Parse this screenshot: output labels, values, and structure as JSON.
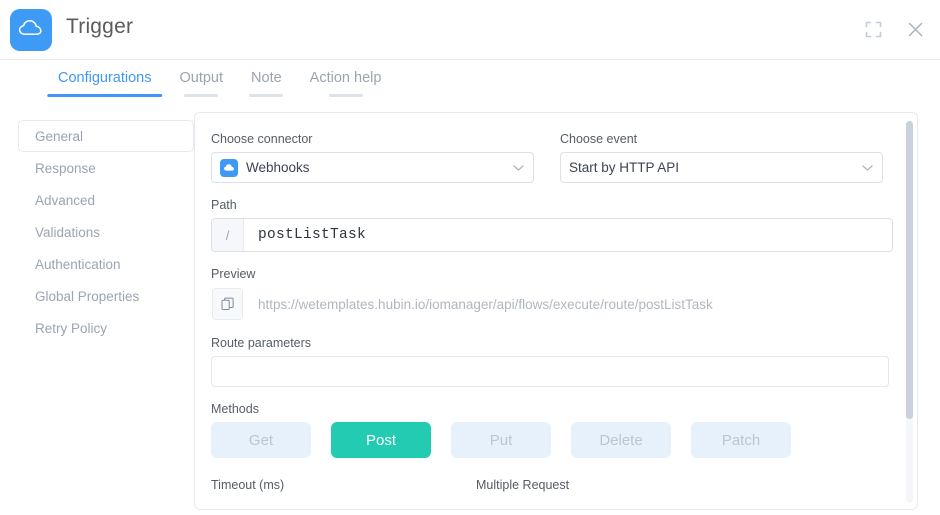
{
  "window": {
    "title": "Trigger",
    "logo_icon": "cloud-icon",
    "expand_icon": "fullscreen-icon",
    "close_icon": "close-icon"
  },
  "tabs": [
    {
      "label": "Configurations",
      "active": true
    },
    {
      "label": "Output",
      "active": false
    },
    {
      "label": "Note",
      "active": false
    },
    {
      "label": "Action help",
      "active": false
    }
  ],
  "sidebar": {
    "items": [
      {
        "label": "General",
        "selected": true
      },
      {
        "label": "Response",
        "selected": false
      },
      {
        "label": "Advanced",
        "selected": false
      },
      {
        "label": "Validations",
        "selected": false
      },
      {
        "label": "Authentication",
        "selected": false
      },
      {
        "label": "Global Properties",
        "selected": false
      },
      {
        "label": "Retry Policy",
        "selected": false
      }
    ]
  },
  "form": {
    "connector": {
      "label": "Choose connector",
      "value": "Webhooks",
      "icon": "cloud-icon",
      "chevron": "chevron-down-icon"
    },
    "event": {
      "label": "Choose event",
      "value": "Start by HTTP API",
      "chevron": "chevron-down-icon"
    },
    "path": {
      "label": "Path",
      "prefix": "/",
      "value": "postListTask",
      "placeholder": ""
    },
    "preview": {
      "label": "Preview",
      "value": "https://wetemplates.hubin.io/iomanager/api/flows/execute/route/postListTask",
      "copy_icon": "copy-icon"
    },
    "route_parameters": {
      "label": "Route parameters",
      "value": "",
      "placeholder": ""
    },
    "methods": {
      "label": "Methods",
      "options": [
        {
          "label": "Get",
          "active": false
        },
        {
          "label": "Post",
          "active": true
        },
        {
          "label": "Put",
          "active": false
        },
        {
          "label": "Delete",
          "active": false
        },
        {
          "label": "Patch",
          "active": false
        }
      ]
    },
    "timeout": {
      "label": "Timeout (ms)"
    },
    "multiple_request": {
      "label": "Multiple Request"
    }
  },
  "colors": {
    "accent_blue": "#4098f4",
    "brand_blue": "#3d9bf5",
    "active_method": "#22cbb2",
    "inactive_method": "#e7f1fb",
    "muted_text": "#9aa5b1"
  }
}
